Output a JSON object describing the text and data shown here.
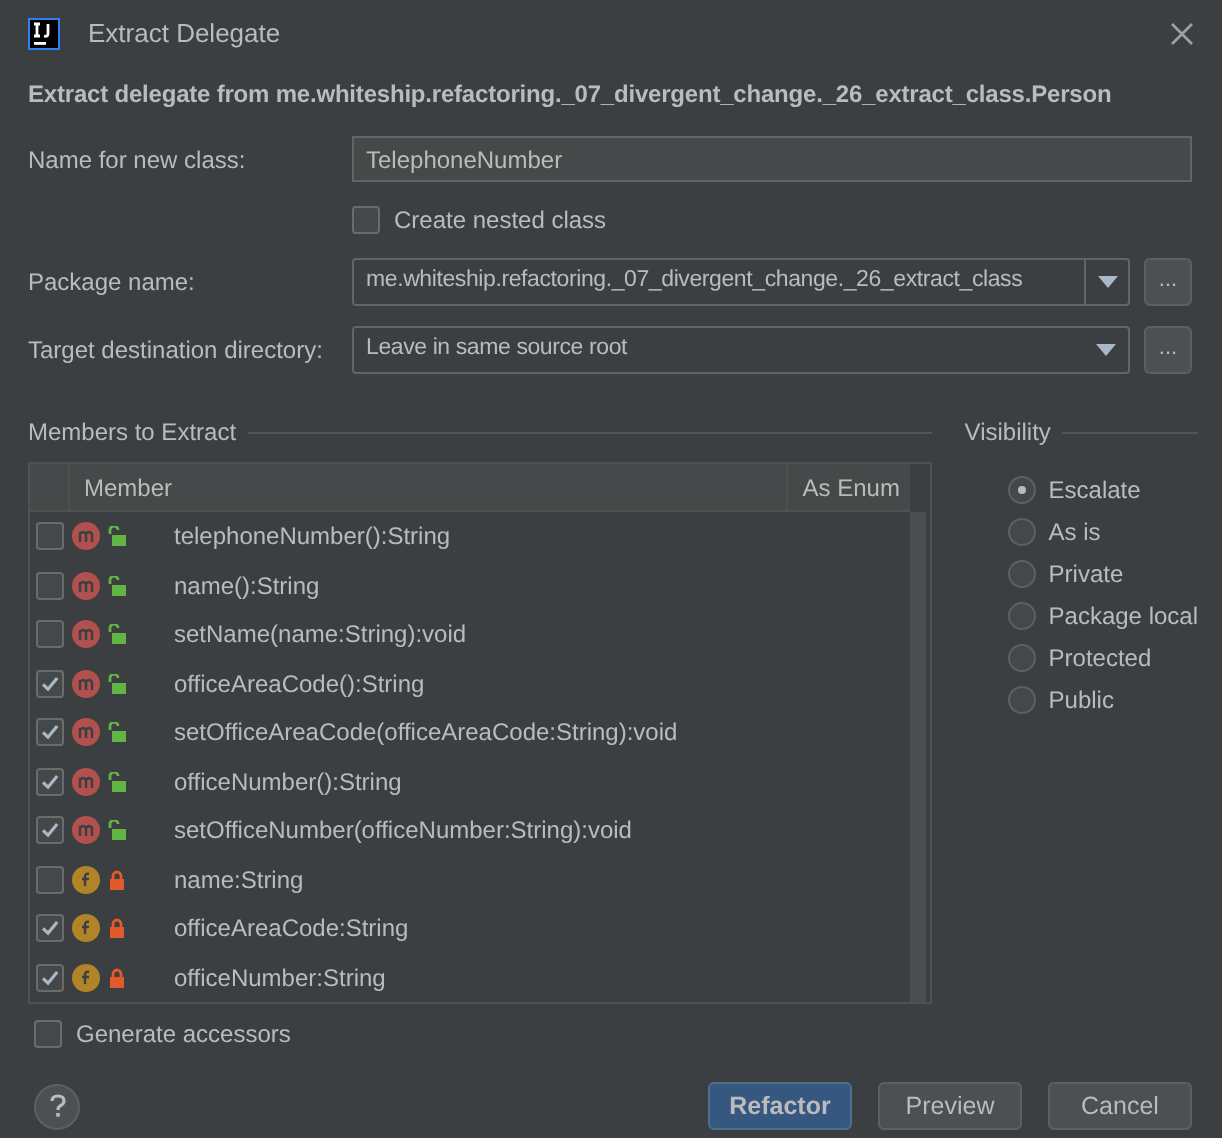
{
  "window": {
    "title": "Extract Delegate"
  },
  "heading": "Extract delegate from me.whiteship.refactoring._07_divergent_change._26_extract_class.Person",
  "name_field": {
    "label": "Name for new class:",
    "value": "TelephoneNumber"
  },
  "nested_checkbox": {
    "label": "Create nested class",
    "checked": false
  },
  "package_field": {
    "label": "Package name:",
    "value": "me.whiteship.refactoring._07_divergent_change._26_extract_class",
    "browse": "..."
  },
  "target_field": {
    "label": "Target destination directory:",
    "value": "Leave in same source root",
    "browse": "..."
  },
  "members": {
    "title": "Members to Extract",
    "columns": [
      "Member",
      "As Enum"
    ],
    "rows": [
      {
        "kind": "method",
        "locked": false,
        "name": "telephoneNumber():String",
        "checked": false
      },
      {
        "kind": "method",
        "locked": false,
        "name": "name():String",
        "checked": false
      },
      {
        "kind": "method",
        "locked": false,
        "name": "setName(name:String):void",
        "checked": false
      },
      {
        "kind": "method",
        "locked": false,
        "name": "officeAreaCode():String",
        "checked": true
      },
      {
        "kind": "method",
        "locked": false,
        "name": "setOfficeAreaCode(officeAreaCode:String):void",
        "checked": true
      },
      {
        "kind": "method",
        "locked": false,
        "name": "officeNumber():String",
        "checked": true
      },
      {
        "kind": "method",
        "locked": false,
        "name": "setOfficeNumber(officeNumber:String):void",
        "checked": true
      },
      {
        "kind": "field",
        "locked": true,
        "name": "name:String",
        "checked": false
      },
      {
        "kind": "field",
        "locked": true,
        "name": "officeAreaCode:String",
        "checked": true
      },
      {
        "kind": "field",
        "locked": true,
        "name": "officeNumber:String",
        "checked": true
      }
    ]
  },
  "visibility": {
    "title": "Visibility",
    "options": [
      {
        "label": "Escalate",
        "selected": true
      },
      {
        "label": "As is",
        "selected": false
      },
      {
        "label": "Private",
        "selected": false
      },
      {
        "label": "Package local",
        "selected": false
      },
      {
        "label": "Protected",
        "selected": false
      },
      {
        "label": "Public",
        "selected": false
      }
    ]
  },
  "generate_accessors": {
    "label": "Generate accessors",
    "checked": false
  },
  "buttons": [
    {
      "label": "Refactor",
      "kind": "primary"
    },
    {
      "label": "Preview",
      "kind": "normal"
    },
    {
      "label": "Cancel",
      "kind": "normal"
    }
  ]
}
